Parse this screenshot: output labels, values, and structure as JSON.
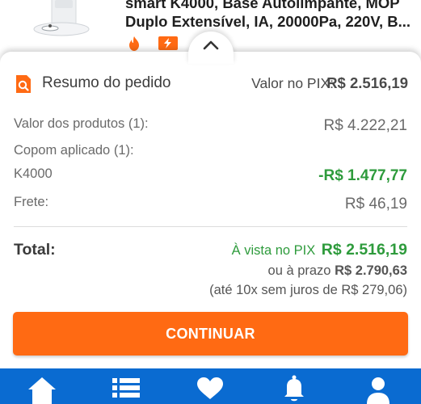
{
  "product": {
    "title_line1": "smart K4000, Base Autolimpante, MOP",
    "title_line2": "Duplo Extensível, IA, 20000Pa, 220V, B...",
    "image_icon": "robot-vacuum-image",
    "badges": [
      "fire-icon",
      "flash-deal-icon"
    ]
  },
  "summary": {
    "icon": "search-receipt-icon",
    "title": "Resumo do pedido",
    "pix_label": "Valor no PIX:",
    "pix_value": "R$ 2.516,19",
    "collapse_icon": "chevron-up-icon"
  },
  "breakdown": {
    "products_label": "Valor dos produtos (1):",
    "products_value": "R$ 4.222,21",
    "coupon_label": "Copom aplicado (1):",
    "coupon_code": "K4000",
    "coupon_discount": "-R$ 1.477,77",
    "shipping_label": "Frete:",
    "shipping_value": "R$ 46,19"
  },
  "total": {
    "label": "Total:",
    "cash_label": "À vista no PIX",
    "cash_value": "R$ 2.516,19",
    "installment_prefix": "ou à prazo",
    "installment_value": "R$ 2.790,63",
    "installment_detail": "(até 10x sem juros de R$ 279,06)"
  },
  "actions": {
    "continue_label": "CONTINUAR"
  },
  "bottom_nav": {
    "items": [
      "home-icon",
      "list-icon",
      "heart-icon",
      "bell-icon",
      "user-icon"
    ]
  },
  "colors": {
    "accent": "#ff6a13",
    "discount_green": "#2e9b3c",
    "nav_blue": "#0a6bd1"
  }
}
